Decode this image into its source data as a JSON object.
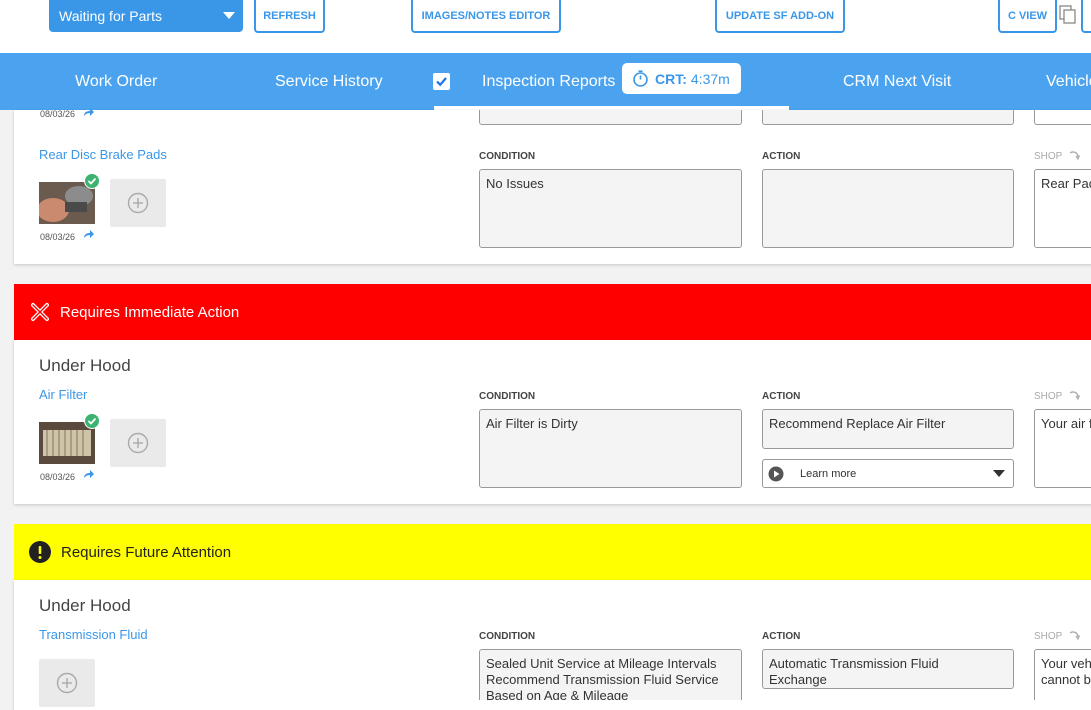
{
  "toolbar": {
    "status_value": "Waiting for Parts",
    "refresh_label": "REFRESH",
    "images_notes_label": "IMAGES/NOTES EDITOR",
    "update_sf_label": "UPDATE SF ADD-ON",
    "c_view_label": "C VIEW"
  },
  "nav": {
    "work_order": "Work Order",
    "service_history": "Service History",
    "inspection_reports": "Inspection Reports",
    "crt_label": "CRT:",
    "crt_value": "4:37m",
    "crm_next_visit": "CRM Next Visit",
    "vehicle": "Vehicle"
  },
  "columns": {
    "condition": "CONDITION",
    "action": "ACTION",
    "shop": "SHOP"
  },
  "top_card": {
    "date": "08/03/26",
    "item_name": "Rear Disc Brake Pads",
    "photo_date": "08/03/26",
    "condition": "No Issues",
    "action": "",
    "shop": "Rear Pad"
  },
  "immediate": {
    "banner": "Requires Immediate Action",
    "section": "Under Hood",
    "item_name": "Air Filter",
    "photo_date": "08/03/26",
    "condition": "Air Filter is Dirty",
    "action": "Recommend Replace Air Filter",
    "learn_more": "Learn more",
    "shop": "Your air f"
  },
  "future": {
    "banner": "Requires Future Attention",
    "section": "Under Hood",
    "item_name": "Transmission Fluid",
    "condition": "Sealed Unit Service at Mileage Intervals\nRecommend Transmission Fluid Service\nBased on Age & Mileage",
    "action": "Automatic Transmission Fluid\nExchange",
    "shop": "Your veh\ncannot b"
  },
  "colors": {
    "accent": "#3a97e8",
    "nav_bg": "#4ba3ef",
    "immediate": "#ff0000",
    "future": "#ffff00",
    "ok_badge": "#3cb371"
  }
}
